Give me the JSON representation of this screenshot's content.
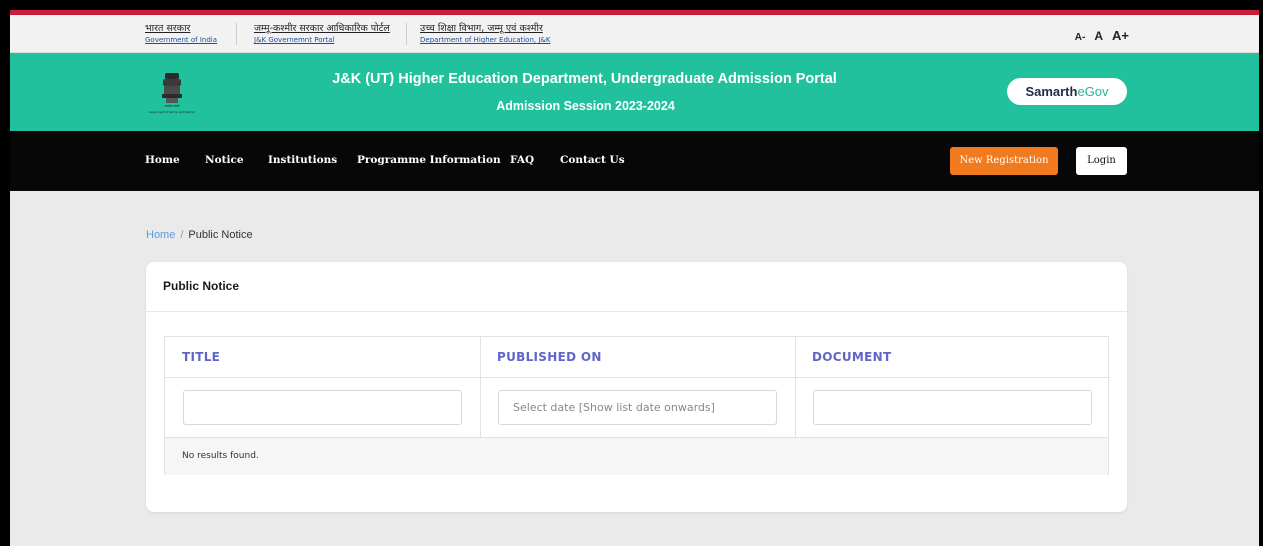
{
  "topbar": {
    "links": [
      {
        "hi": "भारत सरकार",
        "en": "Government of India"
      },
      {
        "hi": "जम्मू-कश्मीर सरकार आधिकारिक पोर्टल",
        "en": "J&K Governemnt Portal"
      },
      {
        "hi": "उच्च शिक्षा विभाग, जम्मू एवं कश्मीर",
        "en": "Department of Higher Education, J&K"
      }
    ],
    "font_size": {
      "small": "A-",
      "normal": "A",
      "large": "A+"
    }
  },
  "banner": {
    "title": "J&K (UT) Higher Education Department, Undergraduate Admission Portal",
    "subtitle": "Admission Session 2023-2024",
    "brand": {
      "part1": "Samarth",
      "part2": "eGov"
    },
    "emblem_caption": "Government of Jammu and Kashmir"
  },
  "nav": {
    "items": [
      "Home",
      "Notice",
      "Institutions",
      "Programme Information",
      "FAQ",
      "Contact Us"
    ],
    "register_label": "New Registration",
    "login_label": "Login"
  },
  "breadcrumb": {
    "home": "Home",
    "separator": "/",
    "current": "Public Notice"
  },
  "notice_card": {
    "title": "Public Notice",
    "columns": [
      "TITLE",
      "PUBLISHED ON",
      "DOCUMENT"
    ],
    "filters": {
      "title_value": "",
      "date_placeholder": "Select date [Show list date onwards]",
      "document_value": ""
    },
    "empty_message": "No results found."
  },
  "colors": {
    "banner": "#20c19c",
    "nav_bg": "#070707",
    "register_button": "#f27a1e",
    "table_header": "#5f66c8",
    "breadcrumb_link": "#5c9be0"
  }
}
